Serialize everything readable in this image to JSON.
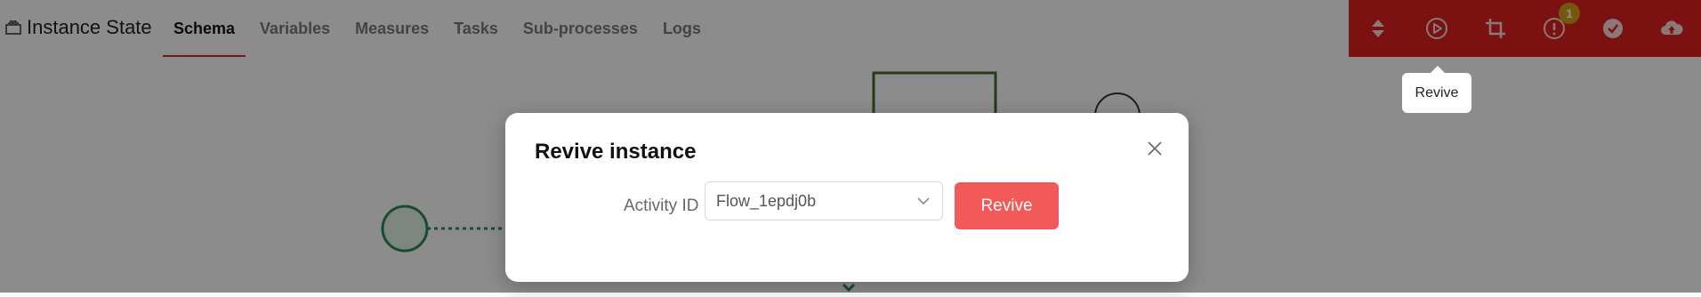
{
  "header": {
    "title": "Instance State",
    "tabs": [
      {
        "label": "Schema",
        "active": true
      },
      {
        "label": "Variables",
        "active": false
      },
      {
        "label": "Measures",
        "active": false
      },
      {
        "label": "Tasks",
        "active": false
      },
      {
        "label": "Sub-processes",
        "active": false
      },
      {
        "label": "Logs",
        "active": false
      }
    ]
  },
  "toolbar": {
    "background_color": "#e02020",
    "items": [
      {
        "icon": "collapse-expand-icon"
      },
      {
        "icon": "play-circle-icon"
      },
      {
        "icon": "crop-icon"
      },
      {
        "icon": "alert-circle-icon",
        "badge": "1"
      },
      {
        "icon": "check-circle-icon"
      },
      {
        "icon": "cloud-upload-icon"
      }
    ],
    "tooltip": "Revive"
  },
  "modal": {
    "title": "Revive instance",
    "field_label": "Activity ID",
    "select_value": "Flow_1epdj0b",
    "submit_label": "Revive",
    "submit_color": "#f25a5a"
  }
}
